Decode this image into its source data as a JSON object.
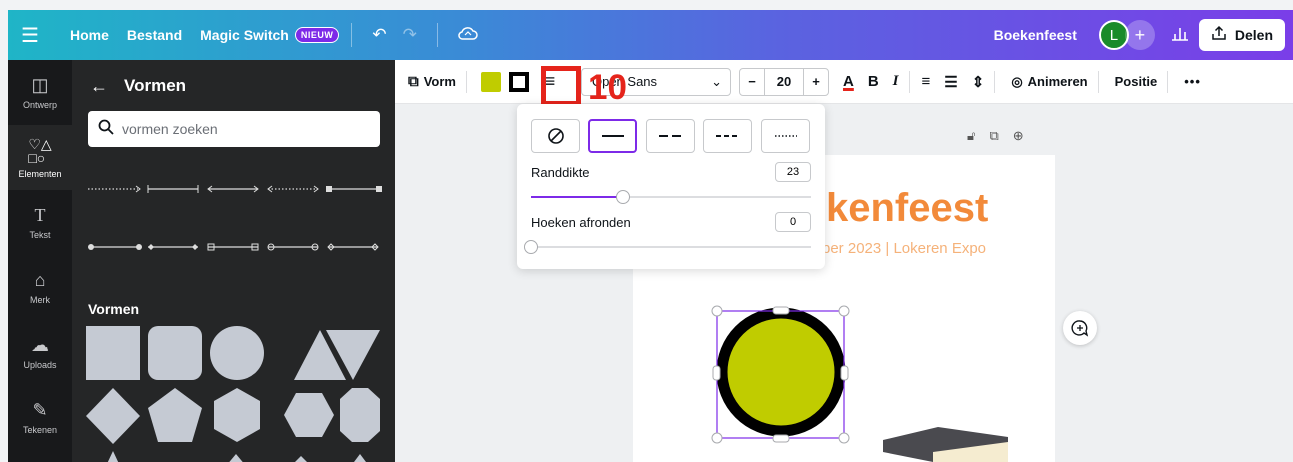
{
  "topbar": {
    "menu_icon": "hamburger-icon",
    "home": "Home",
    "file": "Bestand",
    "magic_switch": "Magic Switch",
    "magic_badge": "NIEUW",
    "doc_title": "Boekenfeest",
    "avatar_letter": "L",
    "share": "Delen",
    "gradient": [
      "#1fb5c7",
      "#7a3ee8"
    ]
  },
  "rail": [
    {
      "label": "Ontwerp",
      "icon": "layout-icon"
    },
    {
      "label": "Elementen",
      "icon": "elements-icon",
      "active": true
    },
    {
      "label": "Tekst",
      "icon": "text-icon"
    },
    {
      "label": "Merk",
      "icon": "brand-icon"
    },
    {
      "label": "Uploads",
      "icon": "upload-cloud-icon"
    },
    {
      "label": "Tekenen",
      "icon": "draw-icon"
    }
  ],
  "panel": {
    "title": "Vormen",
    "search_placeholder": "vormen zoeken",
    "section_title": "Vormen"
  },
  "toolbar": {
    "shape": "Vorm",
    "fill_color": "#c0cc00",
    "font": "Open Sans",
    "font_size": "20",
    "animate": "Animeren",
    "position": "Positie"
  },
  "annotation": {
    "number": "10",
    "color": "#e5241b"
  },
  "popover": {
    "border_weight_label": "Randdikte",
    "border_weight_value": "23",
    "border_weight_fraction": 0.23,
    "corner_label": "Hoeken afronden",
    "corner_value": "0",
    "corner_fraction": 0,
    "accent": "#7d2ae8"
  },
  "page": {
    "title": "kenfeest",
    "subtitle": "ber 2023 | Lokeren Expo"
  }
}
